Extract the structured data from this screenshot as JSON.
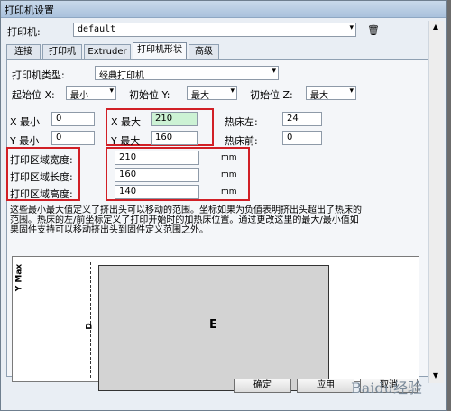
{
  "window": {
    "title": "打印机设置",
    "printer_label": "打印机:",
    "printer_value": "default",
    "printer_arrow": "▾",
    "delete_icon_glyph": "🗑"
  },
  "tabs": [
    {
      "label": "连接"
    },
    {
      "label": "打印机"
    },
    {
      "label": "Extruder"
    },
    {
      "label": "打印机形状"
    },
    {
      "label": "高级"
    }
  ],
  "panel": {
    "printer_type_label": "打印机类型:",
    "printer_type_value": "经典打印机",
    "start_labels": [
      "起始位 X:",
      "初始位 Y:",
      "初始位 Z:"
    ],
    "start_values": [
      "最小",
      "最大",
      "最大"
    ],
    "arrow": "▾",
    "x_min_label": "X 最小",
    "x_min_value": "0",
    "y_min_label": "Y 最小",
    "y_min_value": "0",
    "x_max_label": "X 最大",
    "x_max_value": "210",
    "y_max_label": "Y 最大",
    "y_max_value": "160",
    "bed_left_label": "热床左:",
    "bed_left_value": "24",
    "bed_front_label": "热床前:",
    "bed_front_value": "0",
    "area_width_label": "打印区域宽度:",
    "area_width_value": "210",
    "area_length_label": "打印区域长度:",
    "area_length_value": "160",
    "area_height_label": "打印区域高度:",
    "area_height_value": "140",
    "unit": "mm",
    "description": "这些最小最大值定义了挤出头可以移动的范围。坐标如果为负值表明挤出头超出了热床的范围。热床的左/前坐标定义了打印开始时的加热床位置。通过更改这里的最大/最小值如果固件支持可以移动挤出头到固件定义范围之外。"
  },
  "preview": {
    "axis_label": "Y Max",
    "d_label": "D",
    "e_label": "E"
  },
  "buttons": {
    "ok": "确定",
    "apply": "应用",
    "cancel": "取消"
  },
  "watermark": "Baidu经验"
}
